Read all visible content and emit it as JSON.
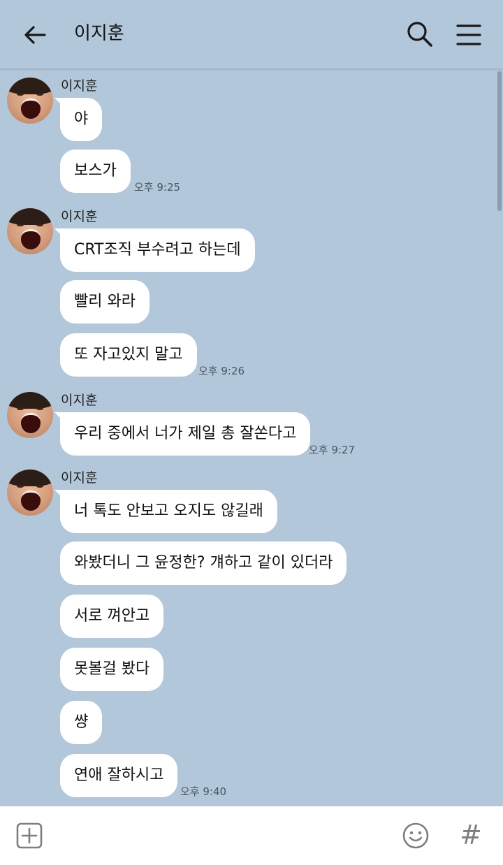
{
  "header": {
    "title": "이지훈",
    "back_icon": "arrow-left-icon",
    "search_icon": "search-icon",
    "menu_icon": "hamburger-menu-icon"
  },
  "messages": {
    "g1": {
      "sender": "이지훈",
      "m1": "야",
      "m2": "보스가",
      "time": "오후 9:25"
    },
    "g2": {
      "sender": "이지훈",
      "m1": "CRT조직 부수려고 하는데",
      "m2": "빨리 와라",
      "m3": "또 자고있지 말고",
      "time": "오후 9:26"
    },
    "g3": {
      "sender": "이지훈",
      "m1": "우리 중에서 너가 제일 총 잘쏜다고",
      "time": "오후 9:27"
    },
    "g4": {
      "sender": "이지훈",
      "m1": "너 톡도 안보고 오지도 않길래",
      "m2": "와봤더니 그 윤정한? 걔하고 같이 있더라",
      "m3": "서로 껴안고",
      "m4": "못볼걸 봤다",
      "m5": "썅",
      "m6": "연애 잘하시고",
      "time": "오후 9:40"
    }
  },
  "bottom": {
    "plus_icon": "plus-square-icon",
    "emoji_icon": "emoji-icon",
    "hash_label": "#"
  },
  "colors": {
    "background": "#b2c7da",
    "bubble": "#ffffff",
    "bottom_bar": "#ffffff"
  }
}
